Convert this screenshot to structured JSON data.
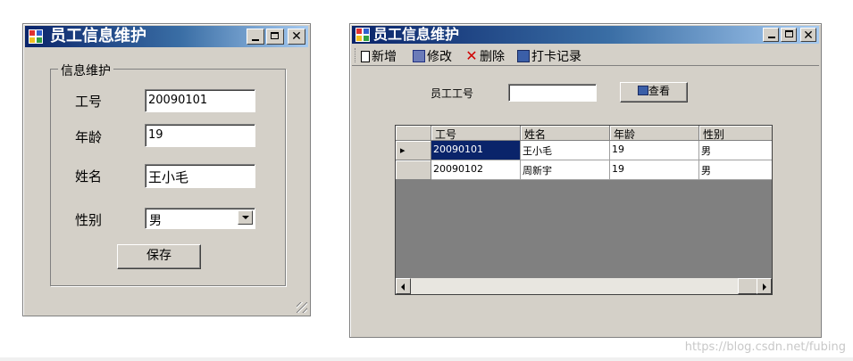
{
  "left_window": {
    "title": "员工信息维护",
    "controls": {
      "minimize": "_",
      "maximize": "□",
      "close": "×"
    },
    "group_title": "信息维护",
    "fields": {
      "id_label": "工号",
      "id_value": "20090101",
      "age_label": "年龄",
      "age_value": "19",
      "name_label": "姓名",
      "name_value": "王小毛",
      "gender_label": "性别",
      "gender_value": "男"
    },
    "save_label": "保存"
  },
  "right_window": {
    "title": "员工信息维护",
    "toolbar": {
      "new": "新增",
      "edit": "修改",
      "delete": "删除",
      "punch": "打卡记录"
    },
    "search": {
      "label": "员工工号",
      "value": "",
      "button": "查看"
    },
    "grid": {
      "columns": [
        "工号",
        "姓名",
        "年龄",
        "性别"
      ],
      "rows": [
        {
          "id": "20090101",
          "name": "王小毛",
          "age": "19",
          "gender": "男"
        },
        {
          "id": "20090102",
          "name": "周新宇",
          "age": "19",
          "gender": "男"
        }
      ],
      "selected_row": 0,
      "row_indicator": "▸"
    }
  },
  "watermark": "https://blog.csdn.net/fubing",
  "colors": {
    "title_start": "#0a246a",
    "title_end": "#a6caf0",
    "selection": "#0a246a",
    "face": "#d4d0c8"
  }
}
